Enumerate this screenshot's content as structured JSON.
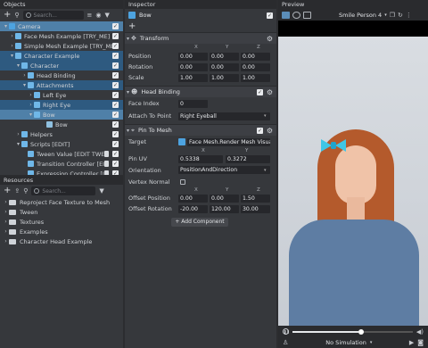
{
  "objects": {
    "title": "Objects",
    "search_placeholder": "Search...",
    "items": [
      {
        "label": "Camera",
        "indent": 0,
        "arrow": "▾",
        "sel": "sel",
        "color": "#4da3e0",
        "chk": true
      },
      {
        "label": "Face Mesh Example [TRY_ME]",
        "indent": 1,
        "arrow": "›",
        "sel": "",
        "color": "#6fb7e8",
        "chk": true
      },
      {
        "label": "Simple Mesh Example [TRY_ME]",
        "indent": 1,
        "arrow": "›",
        "sel": "",
        "color": "#6fb7e8",
        "chk": true
      },
      {
        "label": "Character Example",
        "indent": 1,
        "arrow": "▾",
        "sel": "sel2",
        "color": "#6fb7e8",
        "chk": true
      },
      {
        "label": "Character",
        "indent": 2,
        "arrow": "▾",
        "sel": "sel2",
        "color": "#6fb7e8",
        "chk": true
      },
      {
        "label": "Head Binding",
        "indent": 3,
        "arrow": "›",
        "sel": "",
        "color": "#6fb7e8",
        "chk": true
      },
      {
        "label": "Attachments",
        "indent": 3,
        "arrow": "▾",
        "sel": "sel2",
        "color": "#6fb7e8",
        "chk": true
      },
      {
        "label": "Left Eye",
        "indent": 4,
        "arrow": "›",
        "sel": "",
        "color": "#6fb7e8",
        "chk": true
      },
      {
        "label": "Right Eye",
        "indent": 4,
        "arrow": "›",
        "sel": "sel2",
        "color": "#6fb7e8",
        "chk": true
      },
      {
        "label": "Bow",
        "indent": 4,
        "arrow": "▾",
        "sel": "sel",
        "color": "#6fb7e8",
        "chk": true
      },
      {
        "label": "Bow",
        "indent": 6,
        "arrow": "",
        "sel": "",
        "color": "#8fc0e0",
        "chk": true
      },
      {
        "label": "Helpers",
        "indent": 2,
        "arrow": "›",
        "sel": "",
        "color": "#6fb7e8",
        "chk": true
      },
      {
        "label": "Scripts [EDIT]",
        "indent": 2,
        "arrow": "▾",
        "sel": "",
        "color": "#6fb7e8",
        "chk": true
      },
      {
        "label": "Tween Value [EDIT TWE",
        "indent": 3,
        "arrow": "",
        "sel": "",
        "color": "#6fb7e8",
        "chk": true
      },
      {
        "label": "Transition Controller [EI",
        "indent": 3,
        "arrow": "",
        "sel": "",
        "color": "#6fb7e8",
        "chk": true
      },
      {
        "label": "Expression Controller [I",
        "indent": 3,
        "arrow": "",
        "sel": "",
        "color": "#6fb7e8",
        "chk": true
      }
    ]
  },
  "resources": {
    "title": "Resources",
    "search_placeholder": "Search...",
    "items": [
      "Reproject Face Texture to Mesh",
      "Tween",
      "Textures",
      "Examples",
      "Character Head Example"
    ]
  },
  "inspector": {
    "title": "Inspector",
    "object_name": "Bow",
    "transform": {
      "title": "Transform",
      "x": "X",
      "y": "Y",
      "z": "Z",
      "rows": [
        {
          "label": "Position",
          "v": [
            "0.00",
            "0.00",
            "0.00"
          ]
        },
        {
          "label": "Rotation",
          "v": [
            "0.00",
            "0.00",
            "0.00"
          ]
        },
        {
          "label": "Scale",
          "v": [
            "1.00",
            "1.00",
            "1.00"
          ]
        }
      ]
    },
    "head_binding": {
      "title": "Head Binding",
      "face_index_label": "Face Index",
      "face_index": "0",
      "attach_label": "Attach To Point",
      "attach_value": "Right Eyeball"
    },
    "pin": {
      "title": "Pin To Mesh",
      "target_label": "Target",
      "target_value": "Face Mesh.Render Mesh Visual",
      "x": "X",
      "y": "Y",
      "z": "Z",
      "pin_uv_label": "Pin UV",
      "pin_uv": [
        "0.5338",
        "0.3272"
      ],
      "orientation_label": "Orientation",
      "orientation_value": "PositionAndDirection",
      "vertex_normal_label": "Vertex Normal",
      "offset_pos_label": "Offset Position",
      "offset_pos": [
        "0.00",
        "0.00",
        "1.50"
      ],
      "offset_rot_label": "Offset Rotation",
      "offset_rot": [
        "-20.00",
        "120.00",
        "30.00"
      ]
    },
    "add_component": "+ Add Component"
  },
  "preview": {
    "title": "Preview",
    "person": "Smile Person 4",
    "simulation": "No Simulation"
  },
  "colors": {
    "accent": "#4f80a8",
    "panel": "#36383c"
  }
}
